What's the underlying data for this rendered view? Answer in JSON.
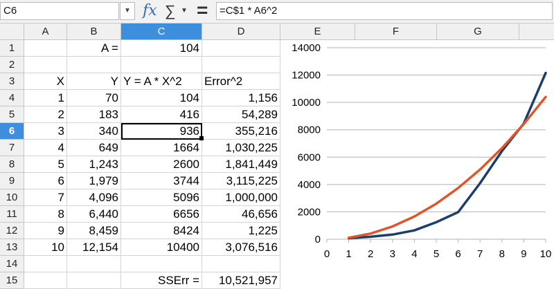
{
  "formula_bar": {
    "name_box": "C6",
    "name_box_dropdown_icon": "chevron-down-icon",
    "function_wizard_icon": "fx-icon",
    "sum_icon": "sigma-icon",
    "formula_icon": "equals-icon",
    "formula": "=C$1 * A6^2"
  },
  "grid": {
    "columns": [
      "A",
      "B",
      "C",
      "D",
      "E",
      "F",
      "G"
    ],
    "active_column": "C",
    "rows": [
      "1",
      "2",
      "3",
      "4",
      "5",
      "6",
      "7",
      "8",
      "9",
      "10",
      "11",
      "12",
      "13",
      "14",
      "15"
    ],
    "active_row": "6",
    "header_active_color": "#3e8ede",
    "r1": {
      "b": "A =",
      "c": "104"
    },
    "r3": {
      "a": "X",
      "b": "Y",
      "c": "Y = A * X^2",
      "d": "Error^2"
    },
    "table": [
      [
        "1",
        "70",
        "104",
        "1,156"
      ],
      [
        "2",
        "183",
        "416",
        "54,289"
      ],
      [
        "3",
        "340",
        "936",
        "355,216"
      ],
      [
        "4",
        "649",
        "1664",
        "1,030,225"
      ],
      [
        "5",
        "1,243",
        "2600",
        "1,841,449"
      ],
      [
        "6",
        "1,979",
        "3744",
        "3,115,225"
      ],
      [
        "7",
        "4,096",
        "5096",
        "1,000,000"
      ],
      [
        "8",
        "6,440",
        "6656",
        "46,656"
      ],
      [
        "9",
        "8,459",
        "8424",
        "1,225"
      ],
      [
        "10",
        "12,154",
        "10400",
        "3,076,516"
      ]
    ],
    "r15": {
      "c": "SSErr =",
      "d": "10,521,957"
    }
  },
  "chart_data": {
    "type": "line",
    "x": [
      1,
      2,
      3,
      4,
      5,
      6,
      7,
      8,
      9,
      10
    ],
    "series": [
      {
        "values": [
          70,
          183,
          340,
          649,
          1243,
          1979,
          4096,
          6440,
          8459,
          12154
        ],
        "color": "#1b3f6b"
      },
      {
        "values": [
          104,
          416,
          936,
          1664,
          2600,
          3744,
          5096,
          6656,
          8424,
          10400
        ],
        "color": "#e0562a"
      }
    ],
    "x_ticks": [
      0,
      1,
      2,
      3,
      4,
      5,
      6,
      7,
      8,
      9,
      10
    ],
    "y_ticks": [
      0,
      2000,
      4000,
      6000,
      8000,
      10000,
      12000,
      14000
    ],
    "xlim": [
      0,
      10
    ],
    "ylim": [
      0,
      14000
    ],
    "grid": "horizontal",
    "legend": "none"
  }
}
